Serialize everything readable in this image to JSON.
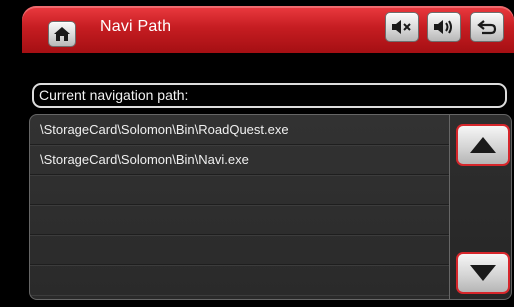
{
  "header": {
    "title": "Navi Path",
    "icons": {
      "home": "home-icon",
      "mute": "speaker-mute-icon",
      "volume": "speaker-volume-icon",
      "back": "return-arrow-icon"
    },
    "accent": "#c61d22"
  },
  "path_label": "Current navigation path:",
  "list": {
    "items": [
      "\\StorageCard\\Solomon\\Bin\\RoadQuest.exe",
      " \\StorageCard\\Solomon\\Bin\\Navi.exe",
      "",
      "",
      "",
      ""
    ]
  },
  "scroll": {
    "up_icon": "triangle-up-icon",
    "down_icon": "triangle-down-icon"
  }
}
